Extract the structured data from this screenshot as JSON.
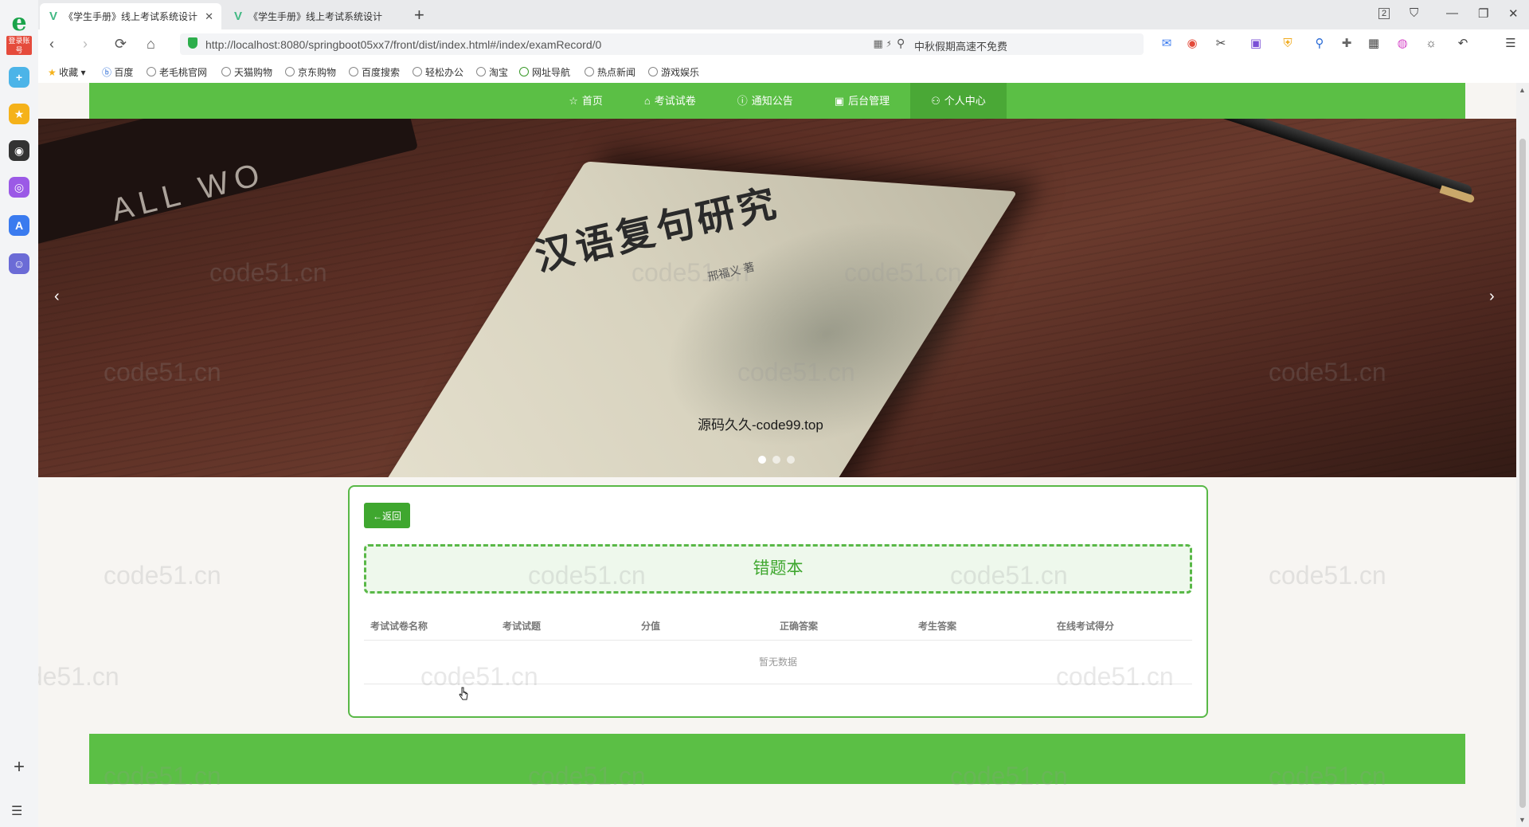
{
  "browser": {
    "tabs": [
      {
        "title": "《学生手册》线上考试系统设计"
      },
      {
        "title": "《学生手册》线上考试系统设计"
      }
    ],
    "url": "http://localhost:8080/springboot05xx7/front/dist/index.html#/index/examRecord/0",
    "search_text": "中秋假期高速不免费",
    "dock_badge": "登录账号",
    "bookmarks": [
      "收藏",
      "百度",
      "老毛桃官网",
      "天猫购物",
      "京东购物",
      "百度搜索",
      "轻松办公",
      "淘宝",
      "网址导航",
      "热点新闻",
      "游戏娱乐"
    ],
    "tab_count_badge": "2"
  },
  "nav": {
    "items": [
      {
        "label": "首页",
        "icon": "star-icon"
      },
      {
        "label": "考试试卷",
        "icon": "bag-icon"
      },
      {
        "label": "通知公告",
        "icon": "info-icon"
      },
      {
        "label": "后台管理",
        "icon": "briefcase-icon"
      },
      {
        "label": "个人中心",
        "icon": "user-icon"
      }
    ],
    "active_index": 4
  },
  "banner": {
    "caption": "源码久久-code99.top",
    "book_title": "汉语复句研究",
    "book_author": "邢福义 著",
    "dark_book_text": "ALL WO",
    "slide_count": 3,
    "active_slide": 0
  },
  "panel": {
    "back_label": "←返回",
    "title": "错题本",
    "columns": [
      "考试试卷名称",
      "考试试题",
      "分值",
      "正确答案",
      "考生答案",
      "在线考试得分"
    ],
    "empty_text": "暂无数据"
  },
  "watermark": "code51.cn",
  "colors": {
    "primary_green": "#5bbf45",
    "button_green": "#3fa72f"
  }
}
